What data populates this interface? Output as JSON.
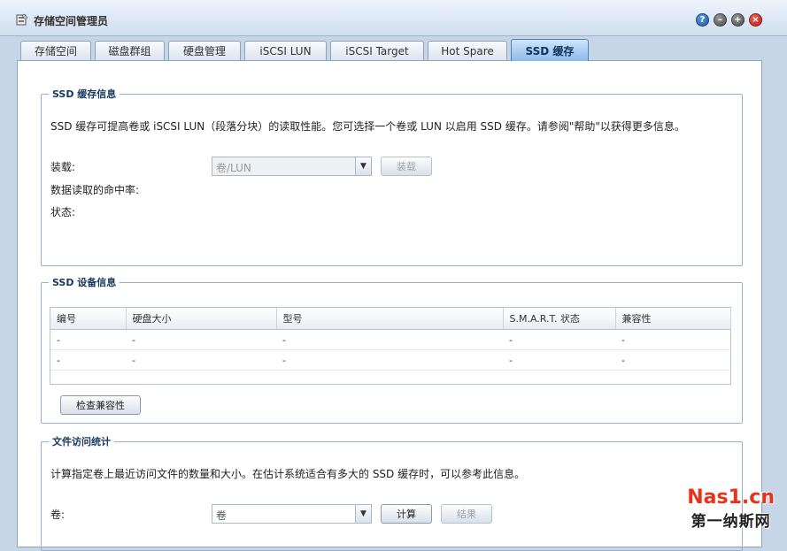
{
  "window": {
    "title": "存储空间管理员",
    "help_glyph": "?",
    "min_glyph": "–",
    "max_glyph": "+",
    "close_glyph": "×"
  },
  "tabs": [
    {
      "label": "存储空间"
    },
    {
      "label": "磁盘群组"
    },
    {
      "label": "硬盘管理"
    },
    {
      "label": "iSCSI LUN"
    },
    {
      "label": "iSCSI Target"
    },
    {
      "label": "Hot Spare"
    },
    {
      "label": "SSD 缓存",
      "active": true
    }
  ],
  "ssd_cache_info": {
    "legend": "SSD 缓存信息",
    "description": "SSD 缓存可提高卷或 iSCSI LUN（段落分块）的读取性能。您可选择一个卷或 LUN 以启用 SSD 缓存。请参阅\"帮助\"以获得更多信息。",
    "mount_label": "装载:",
    "mount_select_value": "卷/LUN",
    "mount_button": "装载",
    "hit_rate_label": "数据读取的命中率:",
    "status_label": "状态:"
  },
  "ssd_device_info": {
    "legend": "SSD 设备信息",
    "columns": [
      "编号",
      "硬盘大小",
      "型号",
      "S.M.A.R.T. 状态",
      "兼容性"
    ],
    "rows": [
      [
        "-",
        "-",
        "-",
        "-",
        "-"
      ],
      [
        "-",
        "-",
        "-",
        "-",
        "-"
      ]
    ],
    "check_button": "检查兼容性"
  },
  "file_access_stats": {
    "legend": "文件访问统计",
    "description": "计算指定卷上最近访问文件的数量和大小。在估计系统适合有多大的 SSD 缓存时，可以参考此信息。",
    "volume_label": "卷:",
    "volume_select_value": "卷",
    "calculate_button": "计算",
    "result_button": "结果"
  },
  "watermark": {
    "site": "Nas1.cn",
    "name": "第一纳斯网"
  }
}
